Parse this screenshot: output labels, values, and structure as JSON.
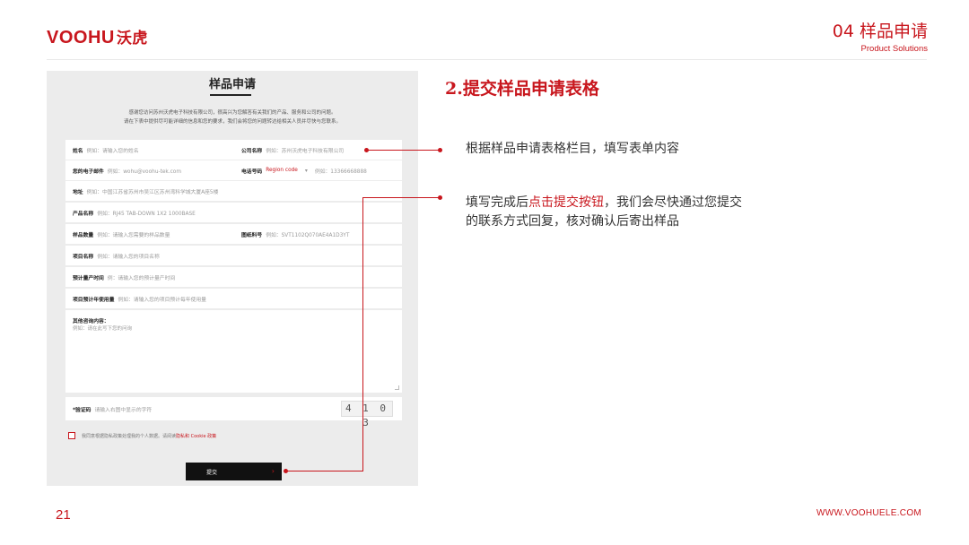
{
  "header": {
    "logo_text": "VOOHU",
    "logo_cn": "沃虎",
    "section_title": "04 样品申请",
    "section_subtitle": "Product Solutions"
  },
  "footer": {
    "page_number": "21",
    "website": "WWW.VOOHUELE.COM"
  },
  "form": {
    "title": "样品申请",
    "intro_line1": "感谢您访问苏州沃虎电子科技有限公司，很高兴为您解答有关我们的产品、服务和公司的问题。",
    "intro_line2": "请在下表中提供尽可能详细的信息和您的要求，我们会将您的问题转达给相关人员并尽快与您联系。",
    "fields": {
      "name_label": "姓名",
      "name_ph": "例如：请输入您的姓名",
      "company_label": "公司名称",
      "company_ph": "例如：苏州沃虎电子科技有限公司",
      "email_label": "您的电子邮件",
      "email_ph": "例如：wohu@voohu-tek.com",
      "phone_label": "电话号码",
      "phone_region": "Region code",
      "phone_ph": "例如：13366668888",
      "address_label": "地址",
      "address_ph": "例如：中国江苏省苏州市吴江区苏州湾科学城大厦A座5楼",
      "product_label": "产品名称",
      "product_ph": "例如：RJ45 TAB-DOWN 1X2 1000BASE",
      "qty_label": "样品数量",
      "qty_ph": "例如：请输入您需要的样品数量",
      "pn_label": "图纸料号",
      "pn_ph": "例如：SVT1102Q070AE4A1D3YT",
      "project_label": "项目名称",
      "project_ph": "例如：请输入您的项目名称",
      "schedule_label": "预计量产时间",
      "schedule_ph": "例：请输入您的预计量产时间",
      "usage_label": "项目预计年使用量",
      "usage_ph": "例如：请输入您的项目预计每年使用量",
      "other_label": "其他咨询内容：",
      "other_ph": "例如：请在此写下您的问询"
    },
    "captcha_label": "*验证码",
    "captcha_ph": "请输入右图中显示的字符",
    "captcha_text": "4 1 0 3",
    "agree_text": "我同意根据隐私政策处理我的个人数据。请阅读",
    "agree_link": "隐私和 Cookie 政策",
    "submit_label": "提交",
    "submit_arrow": "›"
  },
  "content": {
    "step_title": "2.提交样品申请表格",
    "note1": "根据样品申请表格栏目，填写表单内容",
    "note2_pre": "填写完成后",
    "note2_highlight": "点击提交按钮",
    "note2_post": "，我们会尽快通过您提交",
    "note2_line2": "的联系方式回复，核对确认后寄出样品"
  },
  "colors": {
    "accent": "#c8161d",
    "panel_bg": "#ececec",
    "submit_bg": "#111111"
  },
  "icons": [
    "checkbox-icon",
    "chevron-down-icon",
    "arrow-right-icon",
    "resize-handle-icon"
  ]
}
